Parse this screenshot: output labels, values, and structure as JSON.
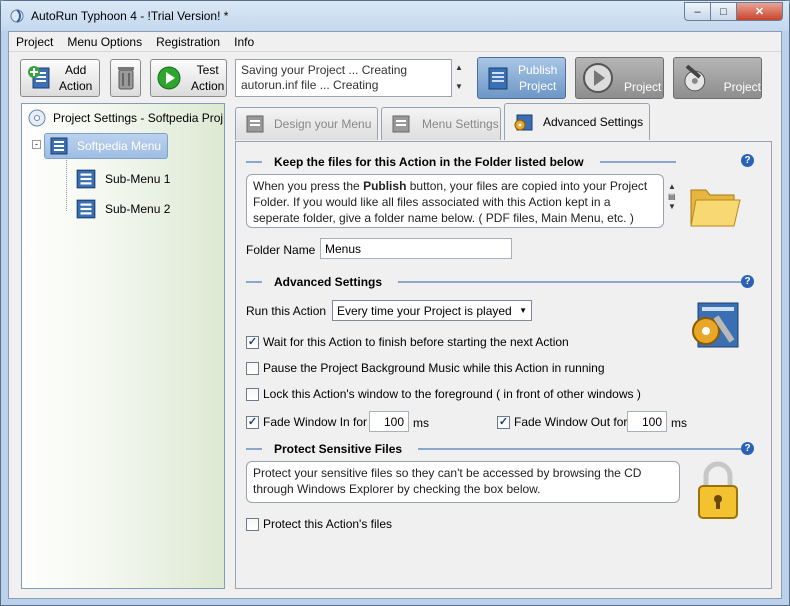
{
  "window": {
    "title": "AutoRun Typhoon 4 - !Trial Version! *",
    "min_label": "–",
    "max_label": "□",
    "close_label": "✕"
  },
  "menu": [
    "Project",
    "Menu Options",
    "Registration",
    "Info"
  ],
  "toolbar": {
    "add_action": "Add\nAction",
    "test_action": "Test\nAction",
    "log": [
      "Saving your Project ... Creating",
      "autorun.inf file ... Creating"
    ],
    "publish_project": "Publish\nProject",
    "project_2": "Project",
    "project_3": "Project"
  },
  "tree": {
    "root": "Project Settings - Softpedia Proj",
    "menu": "Softpedia Menu",
    "sub1": "Sub-Menu 1",
    "sub2": "Sub-Menu 2"
  },
  "tabs": {
    "design": "Design your Menu",
    "menu_settings": "Menu Settings",
    "advanced": "Advanced Settings"
  },
  "keep": {
    "heading": "Keep the files for this Action in the Folder listed below",
    "info_pre": "When you press the ",
    "info_bold": "Publish",
    "info_post": " button, your files are copied into your Project Folder. If you would like all files associated with this Action kept in a seperate folder, give a folder name below. ( PDF files, Main Menu, etc. )",
    "folder_label": "Folder Name",
    "folder_value": "Menus"
  },
  "advanced": {
    "heading": "Advanced Settings",
    "run_label": "Run this Action",
    "run_value": "Every time your Project is played",
    "wait": "Wait for this Action to finish before starting the next Action",
    "pause": "Pause the Project Background Music while this Action in running",
    "lock": "Lock this Action's window to the foreground ( in front of other windows )",
    "fade_in_label": "Fade Window In for",
    "fade_in_value": "100",
    "fade_out_label": "Fade Window Out for",
    "fade_out_value": "100",
    "ms": "ms"
  },
  "protect": {
    "heading": "Protect Sensitive Files",
    "info": "Protect your sensitive files so they can't be accessed by browsing the CD through Windows Explorer by checking the box below.",
    "checkbox": "Protect this Action's files"
  },
  "help_glyph": "?",
  "checks": {
    "wait": true,
    "pause": false,
    "lock": false,
    "fade_in": true,
    "fade_out": true,
    "protect": false
  }
}
